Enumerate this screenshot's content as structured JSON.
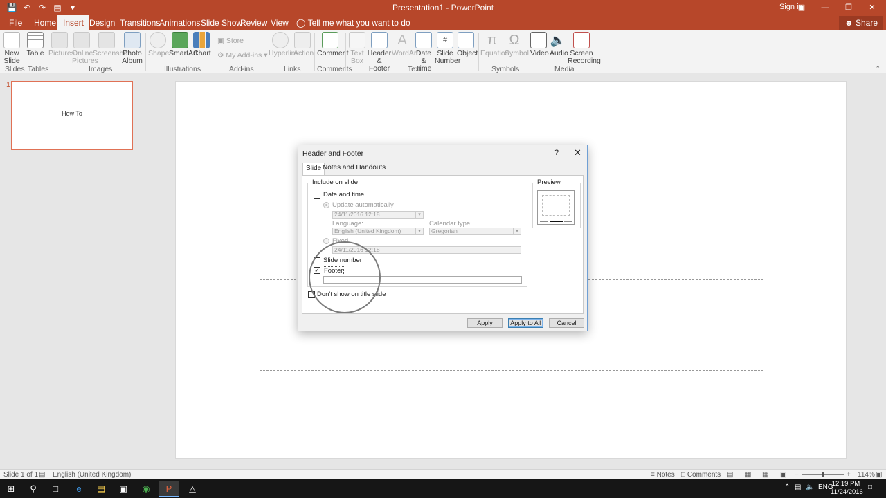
{
  "app": {
    "title": "Presentation1 - PowerPoint",
    "signin": "Sign in",
    "share": "Share",
    "accent": "#b7472a"
  },
  "tabs": [
    "File",
    "Home",
    "Insert",
    "Design",
    "Transitions",
    "Animations",
    "Slide Show",
    "Review",
    "View"
  ],
  "active_tab": "Insert",
  "tell_me": "Tell me what you want to do",
  "ribbon": {
    "slides": {
      "new_slide": "New",
      "new_slide2": "Slide",
      "group": "Slides"
    },
    "tables": {
      "table": "Table",
      "group": "Tables"
    },
    "images": {
      "pictures": "Pictures",
      "online1": "Online",
      "online2": "Pictures",
      "screenshot": "Screenshot",
      "photo1": "Photo",
      "photo2": "Album",
      "group": "Images"
    },
    "illustrations": {
      "shapes": "Shapes",
      "smartart": "SmartArt",
      "chart": "Chart",
      "group": "Illustrations"
    },
    "addins": {
      "store": "Store",
      "my_addins": "My Add-ins",
      "group": "Add-ins"
    },
    "links": {
      "hyperlink": "Hyperlink",
      "action": "Action",
      "group": "Links"
    },
    "comments": {
      "comment": "Comment",
      "group": "Comments"
    },
    "text": {
      "textbox1": "Text",
      "textbox2": "Box",
      "header1": "Header",
      "header2": "& Footer",
      "wordart": "WordArt",
      "date1": "Date &",
      "date2": "Time",
      "slidenum1": "Slide",
      "slidenum2": "Number",
      "object": "Object",
      "group": "Text"
    },
    "symbols": {
      "equation": "Equation",
      "symbol": "Symbol",
      "group": "Symbols"
    },
    "media": {
      "video": "Video",
      "audio": "Audio",
      "screen1": "Screen",
      "screen2": "Recording",
      "group": "Media"
    }
  },
  "thumbnail": {
    "number": "1",
    "text": "How To"
  },
  "dialog": {
    "title": "Header and Footer",
    "help": "?",
    "close": "✕",
    "tab_slide": "Slide",
    "tab_notes": "Notes and Handouts",
    "include_legend": "Include on slide",
    "date_time": "Date and time",
    "update_auto": "Update automatically",
    "date_value": "24/11/2016 12:18",
    "language_label": "Language:",
    "language_value": "English (United Kingdom)",
    "calendar_label": "Calendar type:",
    "calendar_value": "Gregorian",
    "fixed": "Fixed",
    "fixed_value": "24/11/2016 12:18",
    "slide_number": "Slide number",
    "footer": "Footer",
    "footer_value": "",
    "dont_show": "Don't show on title slide",
    "preview": "Preview",
    "apply": "Apply",
    "apply_all": "Apply to All",
    "cancel": "Cancel",
    "checked_footer": true
  },
  "status": {
    "slide_of": "Slide 1 of 1",
    "language": "English (United Kingdom)",
    "notes": "Notes",
    "comments": "Comments",
    "zoom": "114%"
  },
  "taskbar": {
    "lang": "ENG",
    "time": "12:19 PM",
    "date": "11/24/2016"
  }
}
